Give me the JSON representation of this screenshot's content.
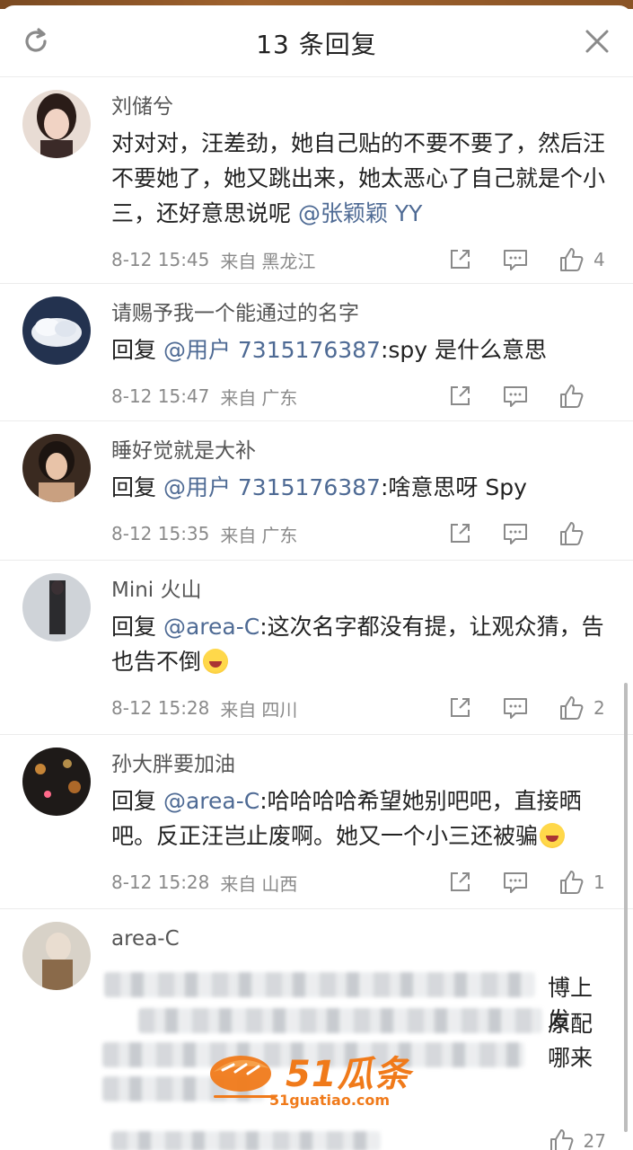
{
  "header": {
    "title": "13 条回复"
  },
  "comments": [
    {
      "name": "刘储兮",
      "text_parts": [
        {
          "t": "对对对，汪差劲，她自己贴的不要不要了，然后汪不要她了，她又跳出来，她太恶心了自己就是个小三，还好意思说呢 "
        },
        {
          "t": "@张颖颖 YY",
          "mention": true
        }
      ],
      "time": "8-12 15:45",
      "from": "来自",
      "location": "黑龙江",
      "likes": "4"
    },
    {
      "name": "请赐予我一个能通过的名字",
      "text_parts": [
        {
          "t": "回复 "
        },
        {
          "t": "@用户 7315176387",
          "mention": true
        },
        {
          "t": ":spy 是什么意思"
        }
      ],
      "time": "8-12 15:47",
      "from": "来自",
      "location": "广东",
      "likes": ""
    },
    {
      "name": "睡好觉就是大补",
      "text_parts": [
        {
          "t": "回复 "
        },
        {
          "t": "@用户 7315176387",
          "mention": true
        },
        {
          "t": ":啥意思呀 Spy"
        }
      ],
      "time": "8-12 15:35",
      "from": "来自",
      "location": "广东",
      "likes": ""
    },
    {
      "name": "Mini 火山",
      "text_parts": [
        {
          "t": "回复 "
        },
        {
          "t": "@area-C",
          "mention": true
        },
        {
          "t": ":这次名字都没有提，让观众猜，告也告不倒"
        },
        {
          "emoji": "laugh-cry"
        }
      ],
      "time": "8-12 15:28",
      "from": "来自",
      "location": "四川",
      "likes": "2"
    },
    {
      "name": "孙大胖要加油",
      "text_parts": [
        {
          "t": "回复 "
        },
        {
          "t": "@area-C",
          "mention": true
        },
        {
          "t": ":哈哈哈哈希望她别吧吧，直接晒吧。反正汪岂止废啊。她又一个小三还被骗"
        },
        {
          "emoji": "laugh-cry"
        }
      ],
      "time": "8-12 15:28",
      "from": "来自",
      "location": "山西",
      "likes": "1"
    },
    {
      "name": "area-C",
      "visible_fragments": [
        "博上发",
        "原配",
        "哪来"
      ],
      "likes": "27"
    }
  ],
  "watermark": {
    "brand": "51瓜条",
    "url": "51guatiao.com"
  },
  "colors": {
    "mention": "#4e6a94",
    "meta": "#8a8a8a",
    "watermark": "#f07a1a"
  }
}
